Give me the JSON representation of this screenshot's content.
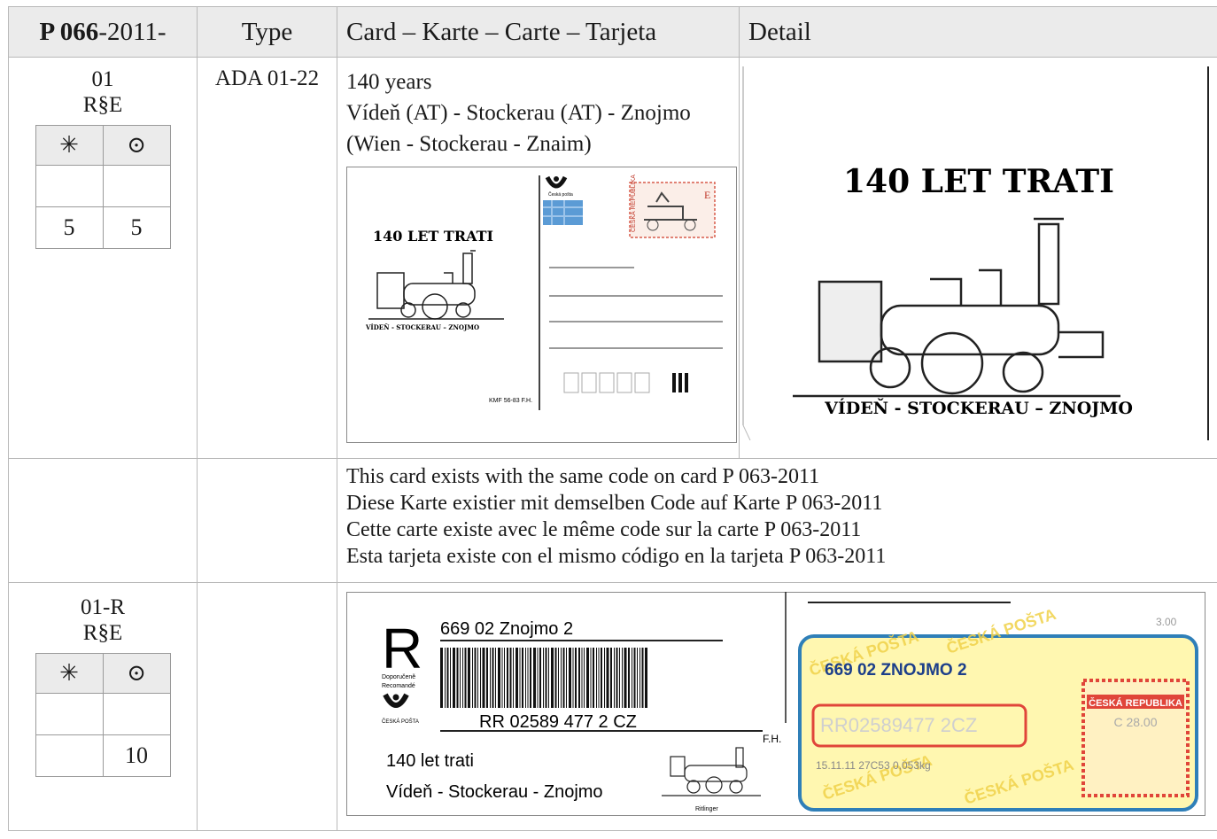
{
  "header": {
    "number_bold": "P 066",
    "number_rest": "-2011-",
    "type": "Type",
    "card": "Card – Karte – Carte – Tarjeta",
    "detail": "Detail"
  },
  "rows": [
    {
      "code": "01",
      "sub": "R§E",
      "mint_symbol": "✳",
      "used_symbol": "⊙",
      "mint_value_1": "",
      "used_value_1": "",
      "mint_value_2": "5",
      "used_value_2": "5",
      "type": "ADA 01-22",
      "desc": [
        "140 years",
        "Vídeň  (AT) - Stockerau (AT) - Znojmo",
        "(Wien - Stockerau - Znaim)"
      ]
    },
    {
      "note": [
        "This card exists with the same code on card P 063-2011",
        "Diese Karte existier mit demselben Code auf Karte P 063-2011",
        "Cette carte existe avec le même code sur la carte P 063-2011",
        "Esta tarjeta existe con el mismo código en la tarjeta P 063-2011"
      ]
    },
    {
      "code": "01-R",
      "sub": "R§E",
      "mint_symbol": "✳",
      "used_symbol": "⊙",
      "mint_value_1": "",
      "used_value_1": "",
      "mint_value_2": "",
      "used_value_2": "10",
      "type": ""
    }
  ],
  "card_image": {
    "title": "140 LET TRATI",
    "route": "VÍDEŇ - STOCKERAU – ZNOJMO",
    "post_label": "Česká pošta",
    "stamp_country": "ČESKÁ REPUBLIKA",
    "stamp_value": "E",
    "imprint": "KMF 56-83 F.H."
  },
  "detail_image": {
    "title": "140 LET TRATI",
    "route": "VÍDEŇ - STOCKERAU – ZNOJMO"
  },
  "registered_image": {
    "r_letter": "R",
    "r_label_1": "Doporučeně",
    "r_label_2": "Recomandé",
    "post_label": "ČESKÁ POŠTA",
    "office": "669 02  Znojmo 2",
    "barcode_number": "RR 02589 477 2 CZ",
    "initials": "F.H.",
    "line1": "140 let trati",
    "line2": "Vídeň - Stockerau - Znojmo",
    "artist": "Ritlinger",
    "corner_mark": "3.00",
    "label_office": "669 02 ZNOJMO 2",
    "label_number": "RR02589477 2CZ",
    "label_date": "15.11.11  27C53  0,053kg",
    "label_country": "ČESKÁ REPUBLIKA",
    "label_value": "C 28.00",
    "watermark": "ČESKÁ POŠTA"
  }
}
